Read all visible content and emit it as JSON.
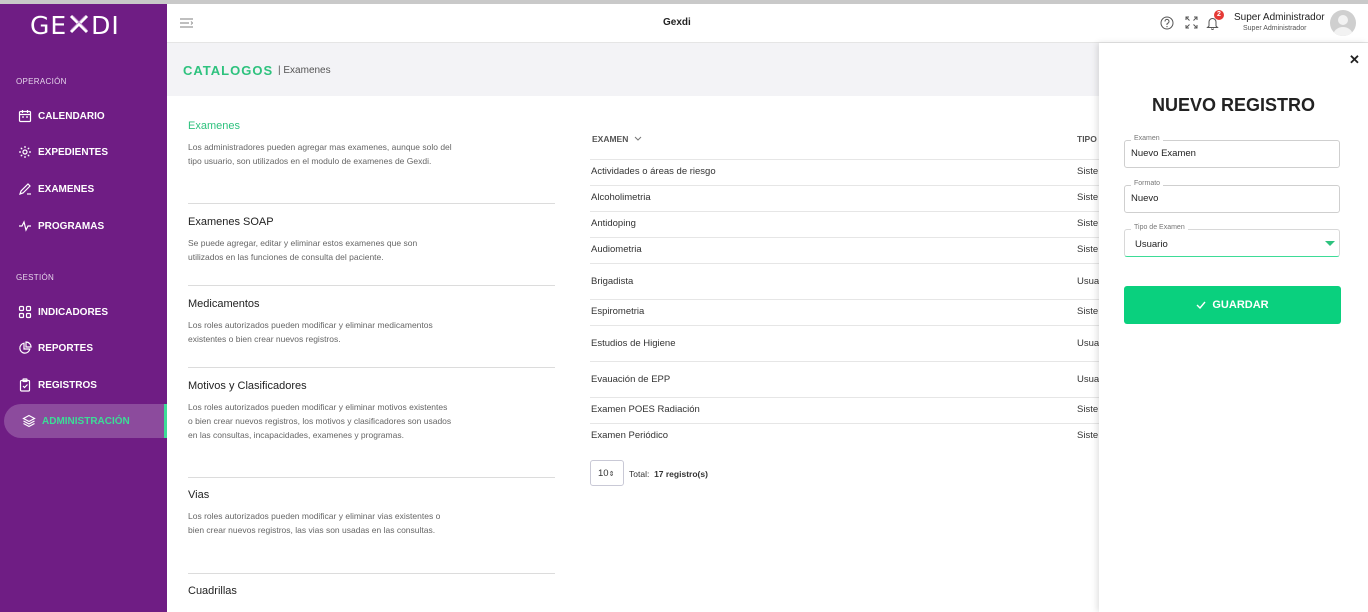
{
  "app": {
    "logo": "GEXDI",
    "logo_left": "GE",
    "logo_right": "DI"
  },
  "sidebar": {
    "sections": [
      {
        "label": "OPERACIÓN"
      },
      {
        "label": "GESTIÓN"
      }
    ],
    "items": [
      {
        "label": "CALENDARIO",
        "icon": "calendar-icon"
      },
      {
        "label": "EXPEDIENTES",
        "icon": "expedientes-icon"
      },
      {
        "label": "EXAMENES",
        "icon": "pen-icon"
      },
      {
        "label": "PROGRAMAS",
        "icon": "pulse-icon"
      },
      {
        "label": "INDICADORES",
        "icon": "grid-icon"
      },
      {
        "label": "REPORTES",
        "icon": "pie-chart-icon"
      },
      {
        "label": "REGISTROS",
        "icon": "clipboard-icon"
      },
      {
        "label": "ADMINISTRACIÓN",
        "icon": "layers-icon",
        "active": true
      }
    ]
  },
  "header": {
    "title": "Gexdi",
    "notifications_count": "2",
    "user_name": "Super Administrador",
    "user_role": "Super Administrador"
  },
  "page": {
    "title": "CATALOGOS",
    "breadcrumb": "| Examenes"
  },
  "catalogs": [
    {
      "title": "Examenes",
      "desc": "Los administradores pueden agregar mas examenes, aunque solo del tipo usuario, son utilizados en el modulo de examenes de Gexdi."
    },
    {
      "title": "Examenes SOAP",
      "desc": "Se puede agregar, editar y eliminar estos examenes que son utilizados en las funciones de consulta del paciente."
    },
    {
      "title": "Medicamentos",
      "desc": "Los roles autorizados pueden modificar y eliminar medicamentos existentes o bien crear nuevos registros."
    },
    {
      "title": "Motivos y Clasificadores",
      "desc": "Los roles autorizados pueden modificar y eliminar motivos existentes o bien crear nuevos registros, los motivos y clasificadores son usados en las consultas, incapacidades, examenes y programas."
    },
    {
      "title": "Vias",
      "desc": "Los roles autorizados pueden modificar y eliminar vias existentes o bien crear nuevos registros, las vias son usadas en las consultas."
    },
    {
      "title": "Cuadrillas",
      "desc": ""
    }
  ],
  "table": {
    "columns": [
      "EXAMEN",
      "TIPO"
    ],
    "rows": [
      {
        "examen": "Actividades o áreas de riesgo",
        "tipo": "Siste"
      },
      {
        "examen": "Alcoholimetria",
        "tipo": "Siste"
      },
      {
        "examen": "Antidoping",
        "tipo": "Siste"
      },
      {
        "examen": "Audiometria",
        "tipo": "Siste"
      },
      {
        "examen": "Brigadista",
        "tipo": "Usua"
      },
      {
        "examen": "Espirometria",
        "tipo": "Siste"
      },
      {
        "examen": "Estudios de Higiene",
        "tipo": "Usua"
      },
      {
        "examen": "Evauación de EPP",
        "tipo": "Usua"
      },
      {
        "examen": "Examen POES Radiación",
        "tipo": "Siste"
      },
      {
        "examen": "Examen Periódico",
        "tipo": "Siste"
      }
    ],
    "page_size": "10",
    "total_label": "Total:",
    "total_value": "17 registro(s)"
  },
  "drawer": {
    "title": "NUEVO REGISTRO",
    "close_label": "✕",
    "fields": [
      {
        "label": "Examen",
        "value": "Nuevo Examen"
      },
      {
        "label": "Formato",
        "value": "Nuevo"
      },
      {
        "label": "Tipo de Examen",
        "value": "Usuario"
      }
    ],
    "save_label": "GUARDAR"
  },
  "colors": {
    "sidebar": "#6f1d84",
    "accent": "#2ec27e",
    "button": "#0ad07e",
    "badge": "#e53935"
  }
}
